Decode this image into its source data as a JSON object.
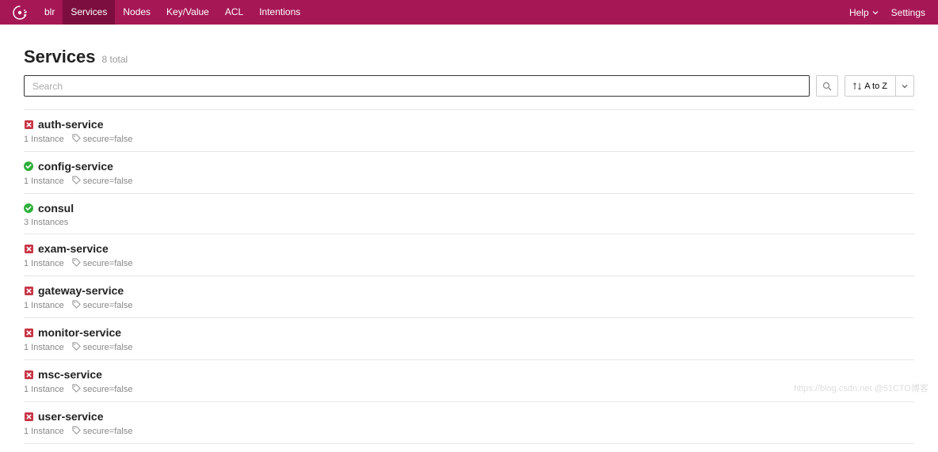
{
  "header": {
    "datacenter": "blr",
    "nav": [
      "Services",
      "Nodes",
      "Key/Value",
      "ACL",
      "Intentions"
    ],
    "activeNav": "Services",
    "help": "Help",
    "settings": "Settings"
  },
  "page": {
    "title": "Services",
    "total": "8 total",
    "searchPlaceholder": "Search",
    "sortLabel": "A to Z"
  },
  "services": [
    {
      "name": "auth-service",
      "status": "critical",
      "instances": "1 Instance",
      "tag": "secure=false"
    },
    {
      "name": "config-service",
      "status": "passing",
      "instances": "1 Instance",
      "tag": "secure=false"
    },
    {
      "name": "consul",
      "status": "passing",
      "instances": "3 Instances",
      "tag": null
    },
    {
      "name": "exam-service",
      "status": "critical",
      "instances": "1 Instance",
      "tag": "secure=false"
    },
    {
      "name": "gateway-service",
      "status": "critical",
      "instances": "1 Instance",
      "tag": "secure=false"
    },
    {
      "name": "monitor-service",
      "status": "critical",
      "instances": "1 Instance",
      "tag": "secure=false"
    },
    {
      "name": "msc-service",
      "status": "critical",
      "instances": "1 Instance",
      "tag": "secure=false"
    },
    {
      "name": "user-service",
      "status": "critical",
      "instances": "1 Instance",
      "tag": "secure=false"
    }
  ],
  "watermark": "https://blog.csdn.net @51CTO博客"
}
